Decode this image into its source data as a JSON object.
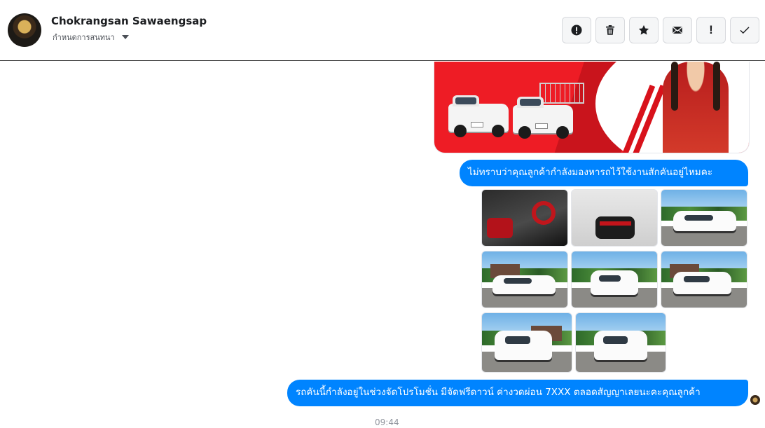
{
  "header": {
    "contact_name": "Chokrangsan Sawaengsap",
    "subtitle": "กำหนดการสนทนา",
    "actions": [
      {
        "name": "report-button",
        "icon": "alert-circle-icon"
      },
      {
        "name": "delete-button",
        "icon": "trash-icon"
      },
      {
        "name": "star-button",
        "icon": "star-icon"
      },
      {
        "name": "mark-unread-button",
        "icon": "envelope-icon"
      },
      {
        "name": "important-button",
        "icon": "exclamation-icon",
        "label": "!"
      },
      {
        "name": "done-button",
        "icon": "check-icon"
      }
    ]
  },
  "messages": {
    "m1": "ไม่ทราบว่าคุณลูกค้ากำลังมองหารถไว้ใช้งานสักคันอยู่ไหมคะ",
    "m2": "รถคันนี้กำลังอยู่ในช่วงจัดโปรโมชั่น มีจัดฟรีดาวน์ ค่างวดผ่อน 7XXX ตลอดสัญญาเลยนะคะคุณลูกค้า",
    "time": "09:44"
  },
  "colors": {
    "bubble": "#0084ff",
    "promo_red": "#ee1c25"
  }
}
